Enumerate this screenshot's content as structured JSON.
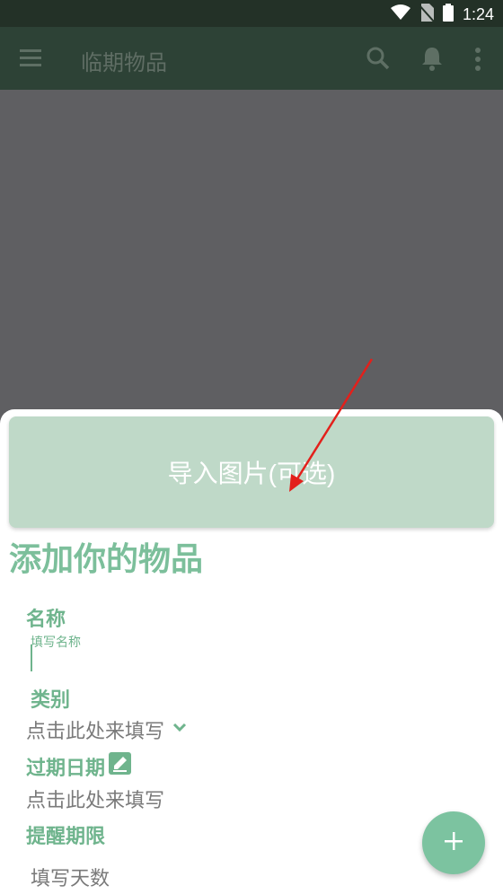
{
  "status_bar": {
    "time": "1:24",
    "icons": [
      "wifi-icon",
      "no-sim-icon",
      "battery-icon"
    ]
  },
  "toolbar": {
    "title": "临期物品",
    "icons": [
      "menu-icon",
      "search-icon",
      "bell-icon",
      "more-vert-icon"
    ]
  },
  "sheet": {
    "import_button_label": "导入图片(可选)",
    "title": "添加你的物品",
    "fields": {
      "name_label": "名称",
      "name_placeholder": "填写名称",
      "category_label": "类别",
      "category_value": "点击此处来填写",
      "expiry_label": "过期日期",
      "expiry_value": "点击此处来填写",
      "reminder_label": "提醒期限",
      "reminder_placeholder": "填写天数"
    }
  },
  "fab": {
    "icon": "plus-icon"
  },
  "colors": {
    "toolbar_bg": "#2d4236",
    "accent": "#6fb48d",
    "import_button_bg": "#bfd9c8",
    "fab_bg": "#7cc3a0",
    "dim_overlay": "#5f5f62",
    "annotation_arrow": "#e3201b"
  }
}
